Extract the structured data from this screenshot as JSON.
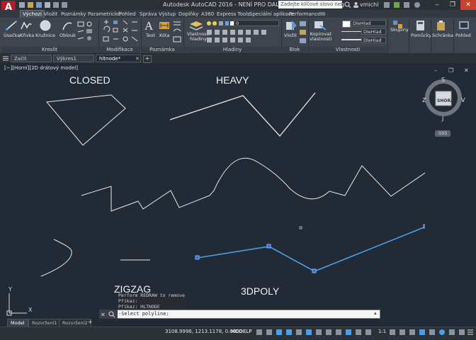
{
  "app": {
    "title": "Autodesk AutoCAD 2016 - NENÍ PRO DALŠÍ PRODEJ    hltnode.dwg",
    "search_placeholder": "Zadejte klíčové slovo nebo výraz",
    "user": "vmichl",
    "logo": "A"
  },
  "ribbon_tabs": [
    "Výchozí",
    "Vložit",
    "Poznámky",
    "Parametrické",
    "Pohled",
    "Správa",
    "Výstup",
    "Doplňky",
    "A360",
    "Express Tools",
    "Speciální aplikace",
    "Performance"
  ],
  "ribbon": {
    "draw": {
      "line": "Úsečka",
      "polyline": "Křivka",
      "circle": "Kružnice",
      "arc": "Oblouk",
      "group": "Kreslit"
    },
    "modify": {
      "group": "Modifikace"
    },
    "annotation": {
      "text": "Text",
      "dimension": "Kóta",
      "group": "Poznámka"
    },
    "layers": {
      "properties_line1": "Vlastnosti",
      "properties_line2": "hladiny",
      "current_layer": "0",
      "group": "Hladiny"
    },
    "block": {
      "insert": "Vložit",
      "group": "Blok"
    },
    "properties": {
      "match_line1": "Kopírovat",
      "match_line2": "vlastnosti",
      "color": "DleHlad",
      "linetype": "DleHlad",
      "lineweight": "DleHlad",
      "group": "Vlastnosti"
    },
    "groups": {
      "label": "Skupiny"
    },
    "utilities": {
      "label": "Pomůcky"
    },
    "clipboard": {
      "label": "Schránka"
    },
    "view": {
      "label": "Pohled"
    }
  },
  "doc_tabs": [
    "Začít",
    "Výkres1",
    "hltnode*"
  ],
  "viewport": {
    "label": "[−][Horní][2D drátový model]",
    "labels": {
      "closed": "CLOSED",
      "heavy": "HEAVY",
      "zigzag": "ZIGZAG",
      "poly3d": "3DPOLY"
    },
    "viewcube": {
      "top": "SHORA",
      "n": "S",
      "s": "J",
      "e": "V",
      "w": "Z",
      "wcs": "GSS"
    },
    "ucs": {
      "y": "Y",
      "x": "X"
    }
  },
  "command": {
    "history": [
      "Perform REDRAW to remove",
      "Příkaz:",
      "Příkaz: HLTNODE"
    ],
    "prompt": "-Select polyline:"
  },
  "layout_tabs": [
    "Model",
    "Rozvržení1",
    "Rozvržení2"
  ],
  "status": {
    "coords": "3108.9996, 1213.1178, 0.0000",
    "model": "MODELP",
    "scale": "1:1"
  },
  "colors": {
    "highlight": "#4a9fe8",
    "grip": "#2f6fd6",
    "bg": "#222a35"
  }
}
